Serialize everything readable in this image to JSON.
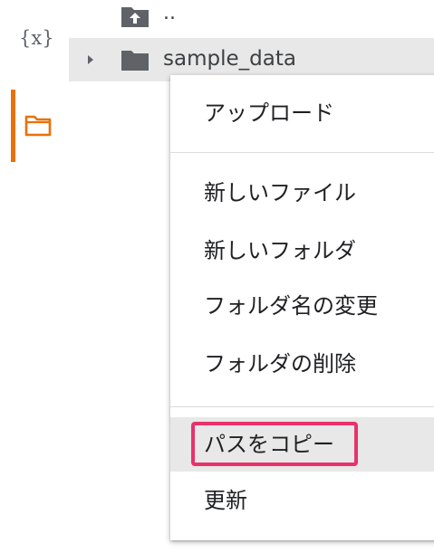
{
  "rail": {
    "variables_glyph": "{x}",
    "accent_color": "#e8710a"
  },
  "file_tree": {
    "parent_label": "..",
    "parent_icon": "folder-up-icon",
    "folder_label": "sample_data",
    "folder_icon": "folder-icon"
  },
  "context_menu": {
    "upload": "アップロード",
    "new_file": "新しいファイル",
    "new_folder": "新しいフォルダ",
    "rename_folder": "フォルダ名の変更",
    "delete_folder": "フォルダの削除",
    "copy_path": "パスをコピー",
    "refresh": "更新",
    "highlight_color": "#e8326b"
  }
}
